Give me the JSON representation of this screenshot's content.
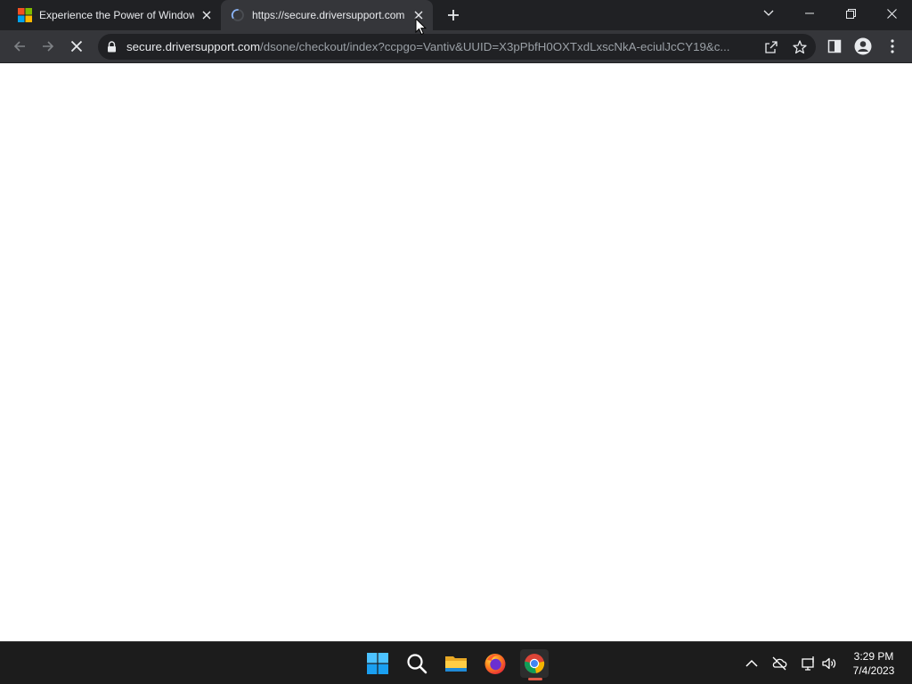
{
  "browser": {
    "tabs": [
      {
        "title": "Experience the Power of Windows",
        "favicon": "windows-logo-icon",
        "active": false,
        "loading": false
      },
      {
        "title": "https://secure.driversupport.com",
        "favicon": "loading-spinner-icon",
        "active": true,
        "loading": true
      }
    ],
    "new_tab_icon": "plus-icon",
    "address_bar": {
      "host": "secure.driversupport.com",
      "path": "/dsone/checkout/index?ccpgo=Vantiv&UUID=X3pPbfH0OXTxdLxscNkA-eciulJcCY19&c..."
    }
  },
  "taskbar": {
    "apps": [
      "start-icon",
      "search-icon",
      "file-explorer-icon",
      "firefox-icon",
      "chrome-icon"
    ],
    "time": "3:29 PM",
    "date": "7/4/2023"
  },
  "colors": {
    "tab_bar": "#202124",
    "toolbar": "#35363a",
    "taskbar": "#1c1c1c",
    "page": "#ffffff"
  }
}
